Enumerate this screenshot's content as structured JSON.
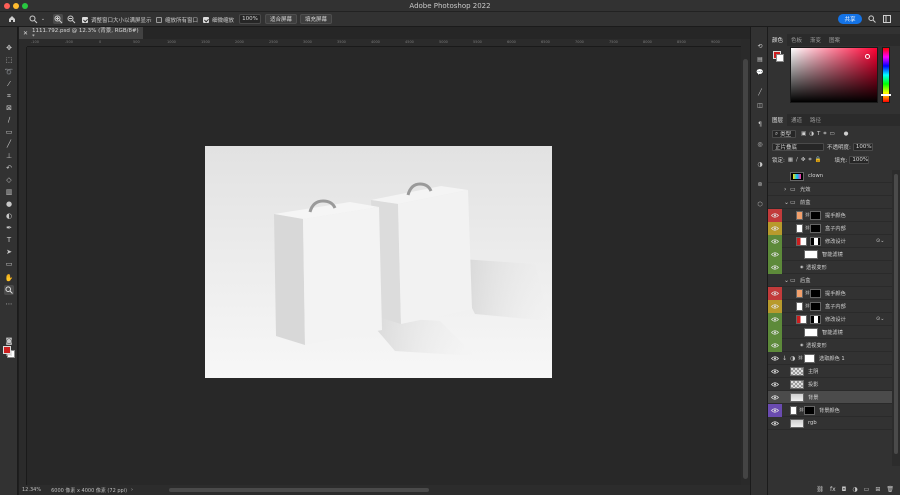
{
  "app": {
    "title": "Adobe Photoshop 2022"
  },
  "options_bar": {
    "resize_windows_label": "调整窗口大小以满屏显示",
    "zoom_all_label": "缩放所有窗口",
    "scrubby_zoom_label": "细微缩放",
    "zoom_value": "100%",
    "fit_screen_label": "适合屏幕",
    "fill_screen_label": "填充屏幕",
    "share_label": "共享",
    "resize_checked": true,
    "zoom_all_checked": false,
    "scrubby_checked": true
  },
  "document": {
    "tab_title": "1111.792.psd @ 12.3% (背景, RGB/8#) *",
    "zoom": "12.34%",
    "size_info": "6000 像素 x 4000 像素 (72 ppi)"
  },
  "ruler": {
    "labels": [
      "-100",
      "-500",
      "0",
      "500",
      "1000",
      "1500",
      "2000",
      "2500",
      "3000",
      "3500",
      "4000",
      "4500",
      "5000",
      "5500",
      "6000",
      "6500",
      "7000",
      "7500",
      "8000",
      "8500",
      "9000"
    ]
  },
  "color_panel": {
    "tabs": [
      "颜色",
      "色板",
      "渐变",
      "图案"
    ],
    "foreground": "#cc1f1f",
    "background": "#ffffff"
  },
  "layers_panel": {
    "tabs": [
      "图层",
      "通道",
      "路径"
    ],
    "filter_label": "类型",
    "blend_mode": "正片叠底",
    "opacity_label": "不透明度:",
    "opacity_value": "100%",
    "lock_label": "锁定:",
    "fill_label": "填充:",
    "fill_value": "100%",
    "layers": [
      {
        "name": "clown",
        "visible": false,
        "color": "",
        "kind": "thumb-multi",
        "indent": 0
      },
      {
        "name": "光效",
        "visible": false,
        "color": "",
        "kind": "folder",
        "indent": 0
      },
      {
        "name": "前盒",
        "visible": false,
        "color": "",
        "kind": "folder-open",
        "indent": 0
      },
      {
        "name": "提手颜色",
        "visible": true,
        "color": "#c23b3b",
        "kind": "fill-mask",
        "indent": 1,
        "fill": "#f2a06c"
      },
      {
        "name": "盒子内部",
        "visible": true,
        "color": "#b89a2c",
        "kind": "fill-mask",
        "indent": 1,
        "fill": "#ffffff"
      },
      {
        "name": "修改设计",
        "visible": true,
        "color": "#5d8a3a",
        "kind": "smart",
        "indent": 1
      },
      {
        "name": "智能滤镜",
        "visible": true,
        "color": "#5d8a3a",
        "kind": "filter",
        "indent": 2
      },
      {
        "name": "透视变形",
        "visible": true,
        "color": "#5d8a3a",
        "kind": "effect",
        "indent": 3
      },
      {
        "name": "后盒",
        "visible": false,
        "color": "",
        "kind": "folder-open",
        "indent": 0
      },
      {
        "name": "提手颜色",
        "visible": true,
        "color": "#c23b3b",
        "kind": "fill-mask",
        "indent": 1,
        "fill": "#f2a06c"
      },
      {
        "name": "盒子内部",
        "visible": true,
        "color": "#b89a2c",
        "kind": "fill-mask",
        "indent": 1,
        "fill": "#ffffff"
      },
      {
        "name": "修改设计",
        "visible": true,
        "color": "#5d8a3a",
        "kind": "smart",
        "indent": 1
      },
      {
        "name": "智能滤镜",
        "visible": true,
        "color": "#5d8a3a",
        "kind": "filter",
        "indent": 2
      },
      {
        "name": "透视变形",
        "visible": true,
        "color": "#5d8a3a",
        "kind": "effect",
        "indent": 3
      },
      {
        "name": "选取颜色 1",
        "visible": true,
        "color": "",
        "kind": "adjust",
        "indent": 0
      },
      {
        "name": "主阴",
        "visible": true,
        "color": "",
        "kind": "thumb",
        "indent": 0
      },
      {
        "name": "投影",
        "visible": true,
        "color": "",
        "kind": "thumb",
        "indent": 0
      },
      {
        "name": "背景",
        "visible": true,
        "color": "",
        "kind": "thumb-bg",
        "indent": 0,
        "selected": true
      },
      {
        "name": "背景颜色",
        "visible": true,
        "color": "#6a4bb0",
        "kind": "fill-mask",
        "indent": 0,
        "fill": "#ffffff"
      },
      {
        "name": "rgb",
        "visible": true,
        "color": "",
        "kind": "thumb-bg",
        "indent": 0
      }
    ]
  },
  "icons": {
    "home": "home-icon",
    "zoom": "zoom-icon"
  }
}
